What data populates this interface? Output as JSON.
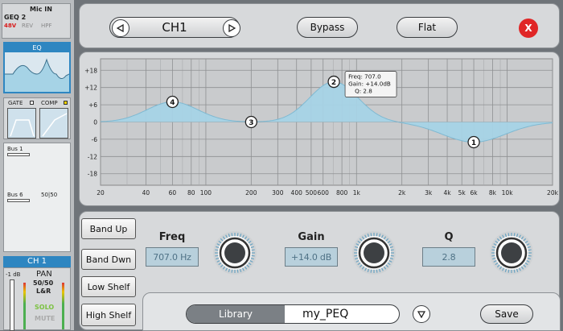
{
  "left": {
    "mic_in": "Mic IN",
    "geq": "GEQ 2",
    "phantom": "48V",
    "rev": "REV",
    "hpf": "HPF",
    "eq_label": "EQ",
    "gate_label": "GATE",
    "comp_label": "COMP",
    "bus1": "Bus 1",
    "bus6": "Bus 6",
    "bus6_pan": "50|50",
    "channel": "CH 1",
    "level": "-1 dB",
    "pan": "PAN",
    "pan_value": "50/50",
    "pan_lr": "L&R",
    "solo": "SOLO",
    "mute": "MUTE"
  },
  "header": {
    "channel_name": "CH1",
    "bypass": "Bypass",
    "flat": "Flat",
    "close": "X"
  },
  "graph": {
    "y_ticks": [
      "+18",
      "+12",
      "+6",
      "0",
      "-6",
      "-12",
      "-18"
    ],
    "x_ticks": [
      "20",
      "40",
      "60",
      "80",
      "100",
      "200",
      "300",
      "400",
      "500",
      "600",
      "800",
      "1k",
      "2k",
      "3k",
      "4k",
      "5k",
      "6k",
      "8k",
      "10k",
      "20k"
    ],
    "tooltip": {
      "freq": "Freq: 707.0",
      "gain": "Gain: +14.0dB",
      "q": "Q: 2.8"
    },
    "bands": [
      {
        "id": "1",
        "freq_hz": 6000,
        "gain_db": -7
      },
      {
        "id": "2",
        "freq_hz": 707,
        "gain_db": 14
      },
      {
        "id": "3",
        "freq_hz": 200,
        "gain_db": 0
      },
      {
        "id": "4",
        "freq_hz": 60,
        "gain_db": 7
      }
    ],
    "fill_color": "#a6d3e6"
  },
  "controls": {
    "band_up": "Band Up",
    "band_down": "Band Dwn",
    "low_shelf": "Low Shelf",
    "high_shelf": "High Shelf",
    "freq_label": "Freq",
    "freq_value": "707.0 Hz",
    "gain_label": "Gain",
    "gain_value": "+14.0 dB",
    "q_label": "Q",
    "q_value": "2.8"
  },
  "library": {
    "tab": "Library",
    "preset": "my_PEQ",
    "save": "Save"
  }
}
